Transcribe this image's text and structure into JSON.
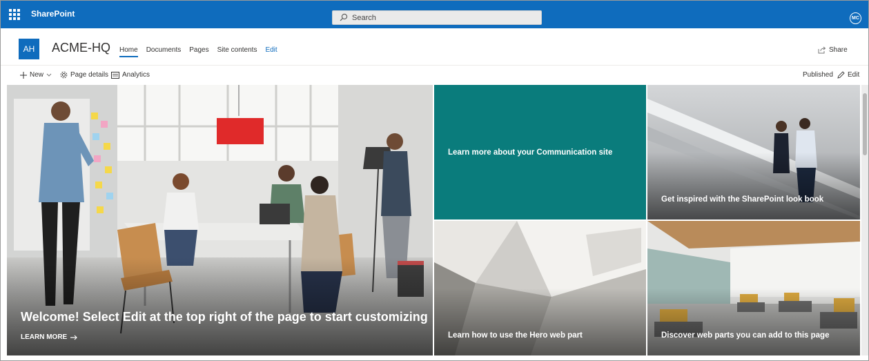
{
  "suite": {
    "app_name": "SharePoint",
    "search_placeholder": "Search",
    "me_initials": "MC"
  },
  "site": {
    "logo_initials": "AH",
    "title": "ACME-HQ",
    "nav": [
      "Home",
      "Documents",
      "Pages",
      "Site contents",
      "Edit"
    ],
    "share_label": "Share"
  },
  "commandbar": {
    "new_label": "New",
    "page_details_label": "Page details",
    "analytics_label": "Analytics",
    "published_label": "Published",
    "edit_label": "Edit"
  },
  "hero": {
    "main": {
      "title": "Welcome! Select Edit at the top right of the page to start customizing",
      "link": "LEARN MORE"
    },
    "tiles": [
      {
        "title": "Learn more about your Communication site",
        "color": "#0a7c7c"
      },
      {
        "title": "Get inspired with the SharePoint look book"
      },
      {
        "title": "Learn how to use the Hero web part"
      },
      {
        "title": "Discover web parts you can add to this page"
      }
    ]
  },
  "colors": {
    "suite_blue": "#0f6cbd",
    "teal": "#0a7c7c"
  }
}
